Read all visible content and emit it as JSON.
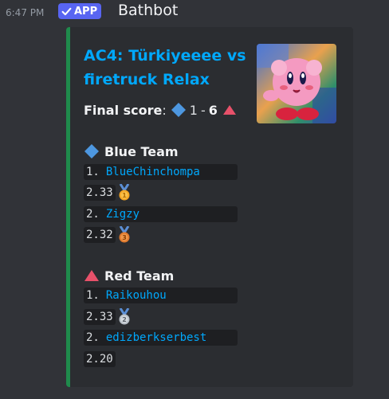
{
  "message": {
    "timestamp": "6:47 PM",
    "badge": "APP",
    "username": "Bathbot"
  },
  "embed": {
    "title": "AC4: Türkiyeeee vs firetruck Relax",
    "accent_color": "#1f8b4c",
    "final_score": {
      "label": "Final score",
      "colon": ":",
      "blue_score": "1",
      "dash": "-",
      "red_score": "6"
    },
    "blue_team": {
      "name": "Blue Team",
      "icon": "blue-diamond-icon",
      "players": [
        {
          "rank": "1.",
          "name": "BlueChinchompa",
          "score": "2.33",
          "medal": "medal-1-icon"
        },
        {
          "rank": "2.",
          "name": "Zigzy",
          "score": "2.32",
          "medal": "medal-3-icon"
        }
      ]
    },
    "red_team": {
      "name": "Red Team",
      "icon": "red-triangle-icon",
      "players": [
        {
          "rank": "1.",
          "name": "Raikouhou",
          "score": "2.33",
          "medal": "medal-2-icon"
        },
        {
          "rank": "2.",
          "name": "edizberkserbest",
          "score": "2.20",
          "medal": ""
        }
      ]
    }
  }
}
